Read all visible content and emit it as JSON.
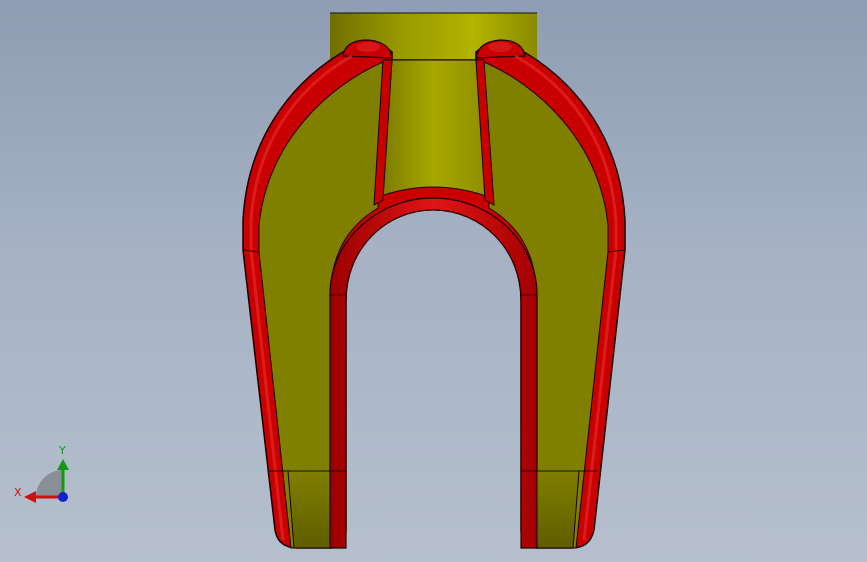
{
  "viewport": {
    "background_top": "#8e9db3",
    "background_bottom": "#b5bfcd"
  },
  "model": {
    "body_color": "#7f7f00",
    "body_highlight": "#b4b400",
    "edge_color": "#c80000",
    "edge_highlight": "#e01515",
    "outline_color": "#1a0000"
  },
  "triad": {
    "x_label": "X",
    "y_label": "Y",
    "x_color": "#cc1111",
    "y_color": "#119911",
    "z_color": "#1122cc"
  }
}
